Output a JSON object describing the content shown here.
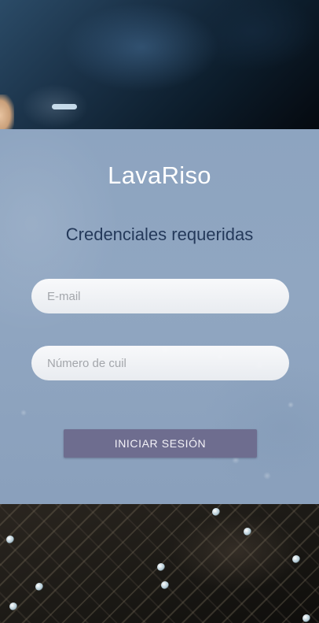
{
  "app": {
    "title": "LavaRiso"
  },
  "form": {
    "heading": "Credenciales requeridas",
    "email": {
      "value": "",
      "placeholder": "E-mail"
    },
    "cuil": {
      "value": "",
      "placeholder": "Número de cuil"
    },
    "submit_label": "INICIAR SESIÓN"
  },
  "colors": {
    "panel": "#8da4c0",
    "title_text": "#ffffff",
    "heading_text": "#24395a",
    "button_bg": "#6e6d8f",
    "button_text": "#f3f2f8"
  }
}
